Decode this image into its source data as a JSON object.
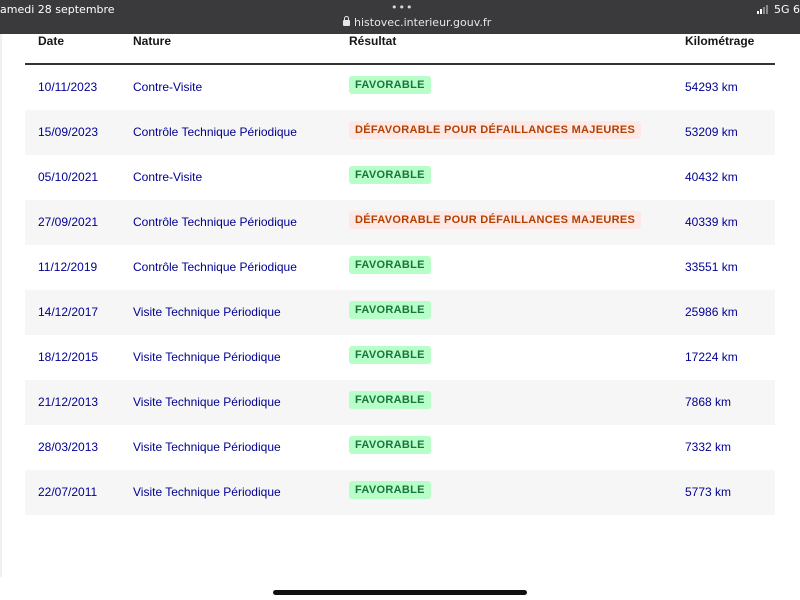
{
  "status_bar": {
    "date": "amedi 28 septembre",
    "url": "histovec.interieur.gouv.fr",
    "network": "5G 6"
  },
  "table": {
    "headers": {
      "date": "Date",
      "nature": "Nature",
      "result": "Résultat",
      "mileage": "Kilométrage"
    },
    "rows": [
      {
        "date": "10/11/2023",
        "nature": "Contre-Visite",
        "result": "FAVORABLE",
        "status": "favorable",
        "mileage": "54293 km"
      },
      {
        "date": "15/09/2023",
        "nature": "Contrôle Technique Périodique",
        "result": "DÉFAVORABLE POUR DÉFAILLANCES MAJEURES",
        "status": "defavorable",
        "mileage": "53209 km"
      },
      {
        "date": "05/10/2021",
        "nature": "Contre-Visite",
        "result": "FAVORABLE",
        "status": "favorable",
        "mileage": "40432 km"
      },
      {
        "date": "27/09/2021",
        "nature": "Contrôle Technique Périodique",
        "result": "DÉFAVORABLE POUR DÉFAILLANCES MAJEURES",
        "status": "defavorable",
        "mileage": "40339 km"
      },
      {
        "date": "11/12/2019",
        "nature": "Contrôle Technique Périodique",
        "result": "FAVORABLE",
        "status": "favorable",
        "mileage": "33551 km"
      },
      {
        "date": "14/12/2017",
        "nature": "Visite Technique Périodique",
        "result": "FAVORABLE",
        "status": "favorable",
        "mileage": "25986 km"
      },
      {
        "date": "18/12/2015",
        "nature": "Visite Technique Périodique",
        "result": "FAVORABLE",
        "status": "favorable",
        "mileage": "17224 km"
      },
      {
        "date": "21/12/2013",
        "nature": "Visite Technique Périodique",
        "result": "FAVORABLE",
        "status": "favorable",
        "mileage": "7868 km"
      },
      {
        "date": "28/03/2013",
        "nature": "Visite Technique Périodique",
        "result": "FAVORABLE",
        "status": "favorable",
        "mileage": "7332 km"
      },
      {
        "date": "22/07/2011",
        "nature": "Visite Technique Périodique",
        "result": "FAVORABLE",
        "status": "favorable",
        "mileage": "5773 km"
      }
    ]
  },
  "colors": {
    "text_blue": "#000091",
    "favorable_bg": "#b8fec9",
    "favorable_text": "#18753c",
    "defavorable_bg": "#ffe9e6",
    "defavorable_text": "#b34000"
  }
}
